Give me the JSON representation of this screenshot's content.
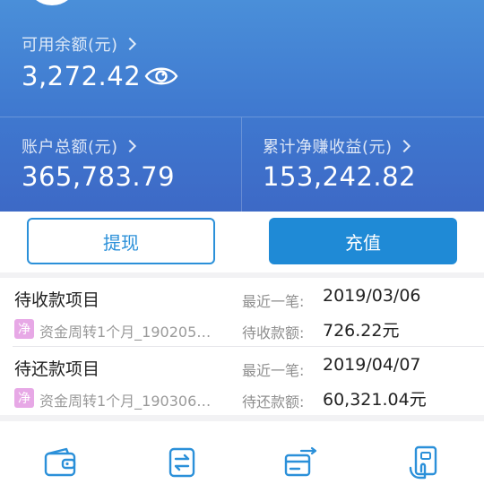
{
  "account": {
    "available_label": "可用余额(元)",
    "available_amount": "3,272.42",
    "total_label": "账户总额(元)",
    "total_amount": "365,783.79",
    "profit_label": "累计净赚收益(元)",
    "profit_amount": "153,242.82"
  },
  "actions": {
    "withdraw_label": "提现",
    "recharge_label": "充值"
  },
  "receivable": {
    "title": "待收款项目",
    "tag": "净",
    "project": "资金周转1个月_190205…",
    "latest_label": "最近一笔:",
    "latest_date": "2019/03/06",
    "amount_label": "待收款额:",
    "amount": "726.22元"
  },
  "repayable": {
    "title": "待还款项目",
    "tag": "净",
    "project": "资金周转1个月_190306…",
    "latest_label": "最近一笔:",
    "latest_date": "2019/04/07",
    "amount_label": "待还款额:",
    "amount": "60,321.04元"
  },
  "tabbar": {
    "icons": [
      "wallet-icon",
      "transfer-icon",
      "card-transfer-icon",
      "phone-card-icon"
    ],
    "accent": "#2b90d9"
  },
  "colors": {
    "hero_top": "#4a8fd9",
    "hero_bottom": "#3d69c6",
    "accent": "#1f8ad6",
    "tag": "#e7a8e6"
  }
}
